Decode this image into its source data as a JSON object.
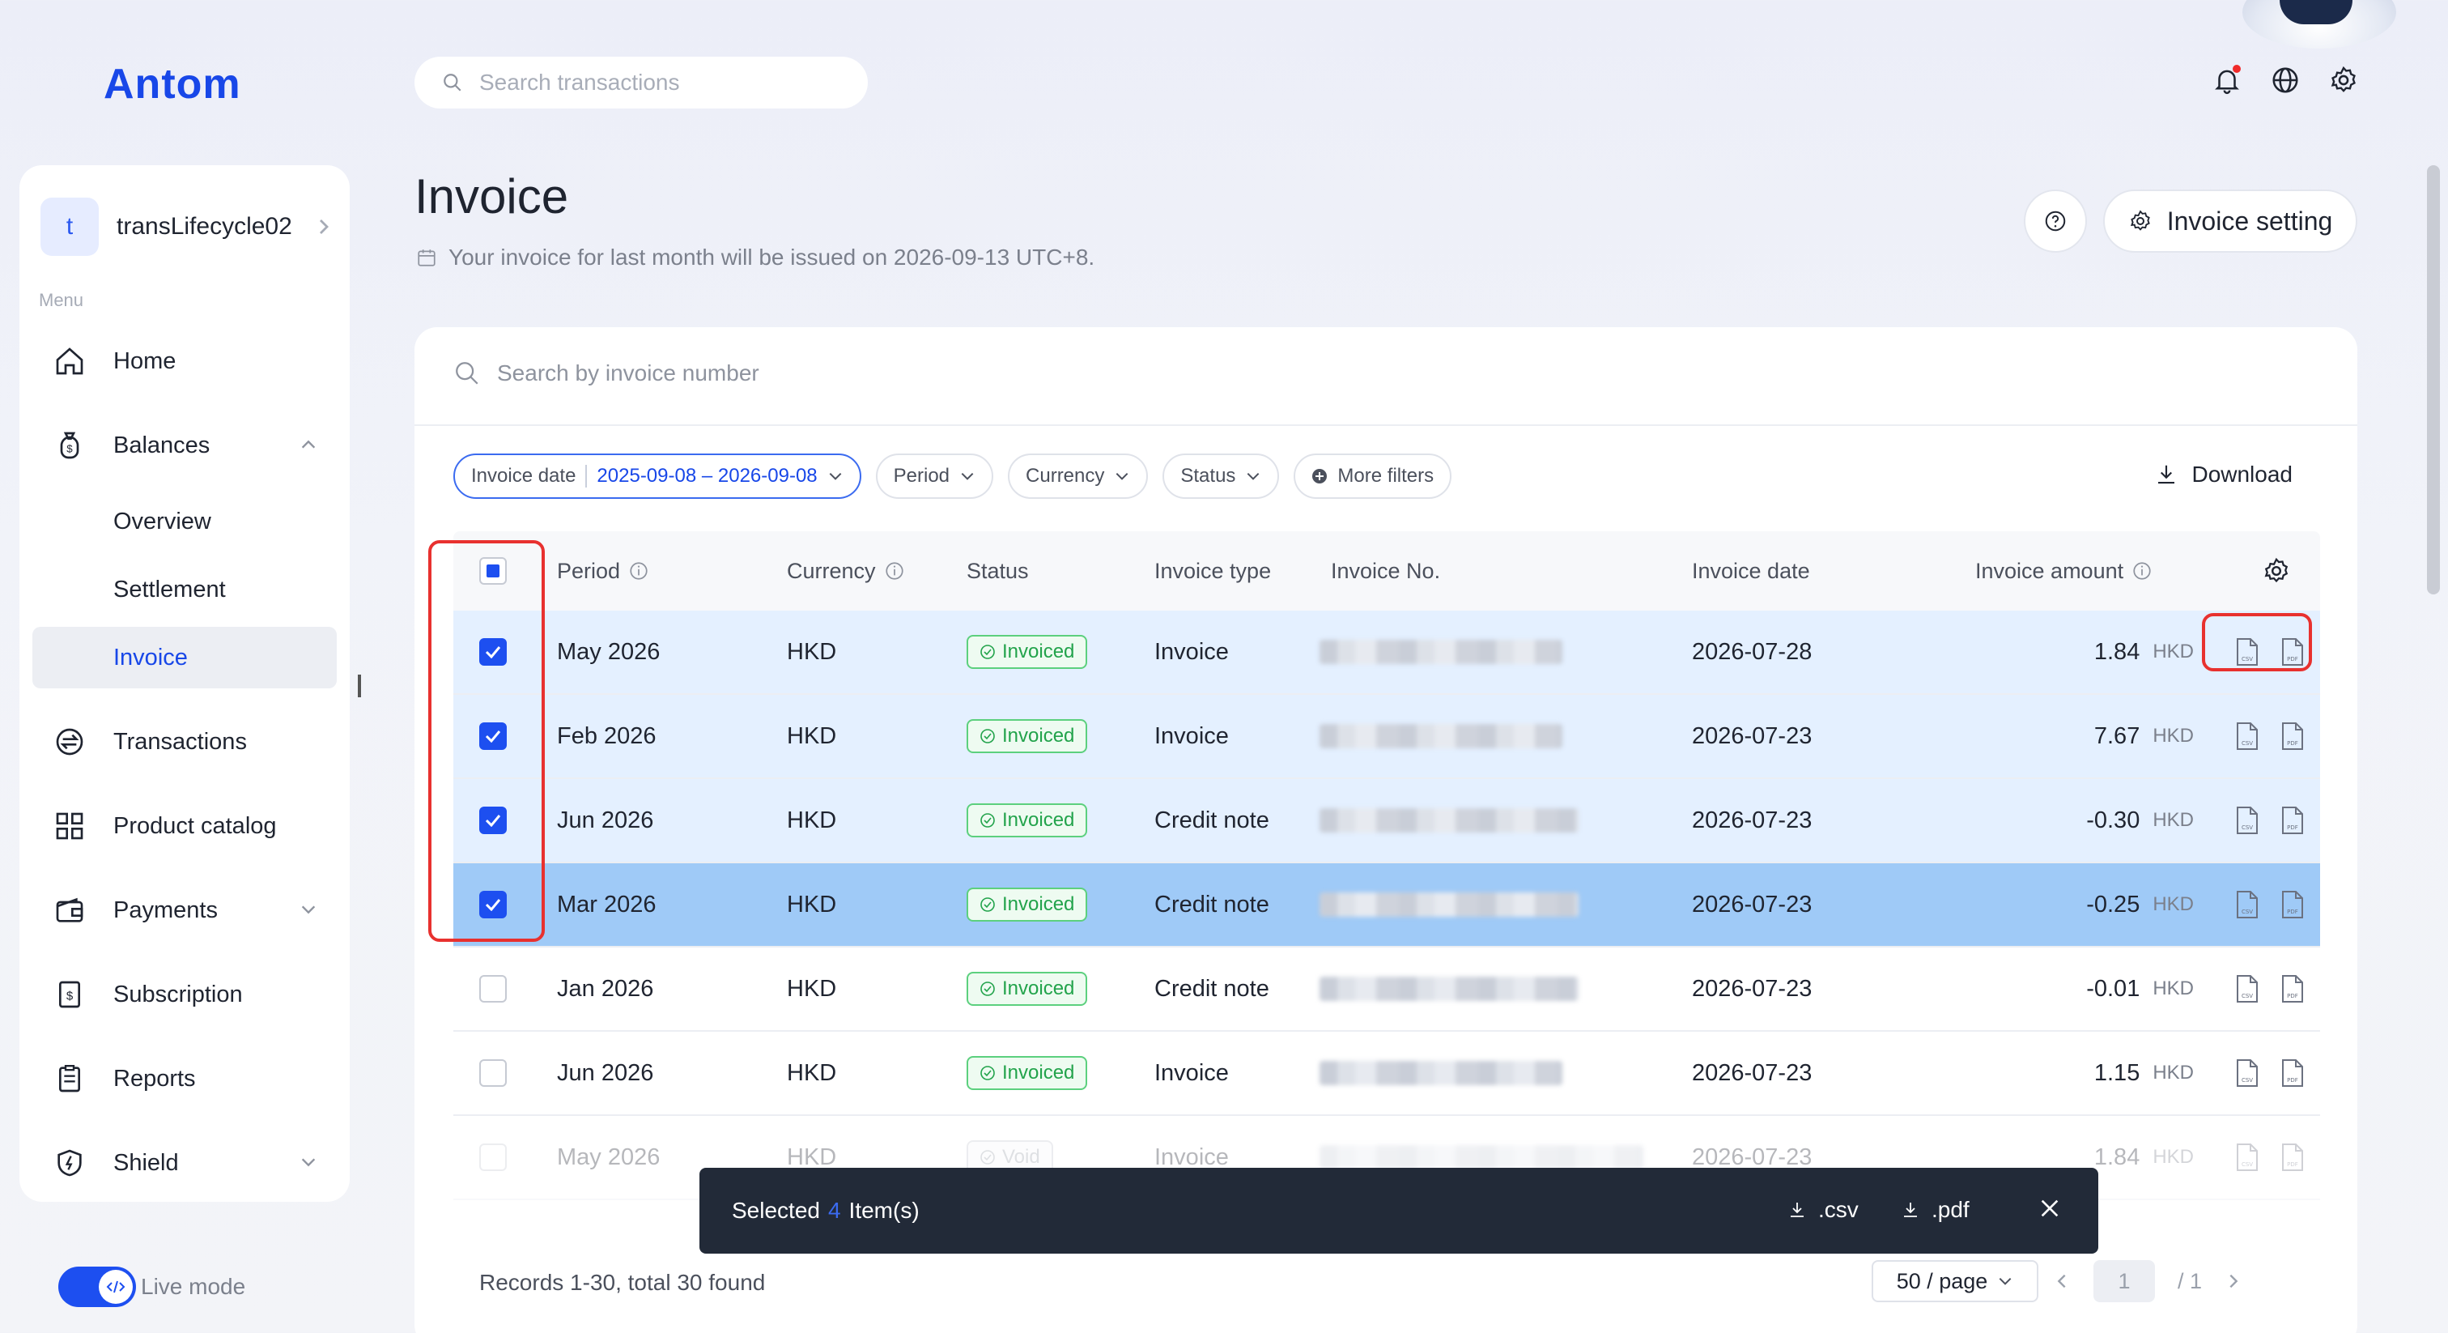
{
  "app": {
    "logo_text": "Antom",
    "search_placeholder": "Search transactions",
    "brand_color": "#1847e8"
  },
  "sidebar": {
    "account": {
      "initial": "t",
      "name": "transLifecycle02"
    },
    "menu_label": "Menu",
    "items": {
      "home": "Home",
      "balances": "Balances",
      "overview": "Overview",
      "settlement": "Settlement",
      "invoice": "Invoice",
      "transactions": "Transactions",
      "product_catalog": "Product catalog",
      "payments": "Payments",
      "subscription": "Subscription",
      "reports": "Reports",
      "shield": "Shield"
    },
    "live_mode": "Live mode"
  },
  "header": {
    "title": "Invoice",
    "subtitle": "Your invoice for last month will be issued on 2026-09-13 UTC+8.",
    "invoice_setting": "Invoice setting"
  },
  "filters": {
    "search_placeholder": "Search by invoice number",
    "invoice_date_label": "Invoice date",
    "invoice_date_value": "2025-09-08 – 2026-09-08",
    "period": "Period",
    "currency": "Currency",
    "status": "Status",
    "more": "More filters",
    "download": "Download"
  },
  "table": {
    "columns": {
      "period": "Period",
      "currency": "Currency",
      "status": "Status",
      "invoice_type": "Invoice type",
      "invoice_no": "Invoice No.",
      "invoice_date": "Invoice date",
      "invoice_amount": "Invoice amount"
    },
    "rows": [
      {
        "period": "May 2026",
        "currency": "HKD",
        "status": "Invoiced",
        "type": "Invoice",
        "date": "2026-07-28",
        "amount": "1.84",
        "cur": "HKD"
      },
      {
        "period": "Feb 2026",
        "currency": "HKD",
        "status": "Invoiced",
        "type": "Invoice",
        "date": "2026-07-23",
        "amount": "7.67",
        "cur": "HKD"
      },
      {
        "period": "Jun 2026",
        "currency": "HKD",
        "status": "Invoiced",
        "type": "Credit note",
        "date": "2026-07-23",
        "amount": "-0.30",
        "cur": "HKD"
      },
      {
        "period": "Mar 2026",
        "currency": "HKD",
        "status": "Invoiced",
        "type": "Credit note",
        "date": "2026-07-23",
        "amount": "-0.25",
        "cur": "HKD"
      },
      {
        "period": "Jan 2026",
        "currency": "HKD",
        "status": "Invoiced",
        "type": "Credit note",
        "date": "2026-07-23",
        "amount": "-0.01",
        "cur": "HKD"
      },
      {
        "period": "Jun 2026",
        "currency": "HKD",
        "status": "Invoiced",
        "type": "Invoice",
        "date": "2026-07-23",
        "amount": "1.15",
        "cur": "HKD"
      },
      {
        "period": "May 2026",
        "currency": "HKD",
        "status": "Void",
        "type": "Invoice",
        "date": "2026-07-23",
        "amount": "1.84",
        "cur": "HKD"
      }
    ]
  },
  "selection_bar": {
    "prefix": "Selected",
    "count": "4",
    "suffix": "Item(s)",
    "csv": ".csv",
    "pdf": ".pdf"
  },
  "footer": {
    "records": "Records 1-30, total 30 found",
    "page_size": "50 / page",
    "current_page": "1",
    "total_pages": "/ 1"
  }
}
